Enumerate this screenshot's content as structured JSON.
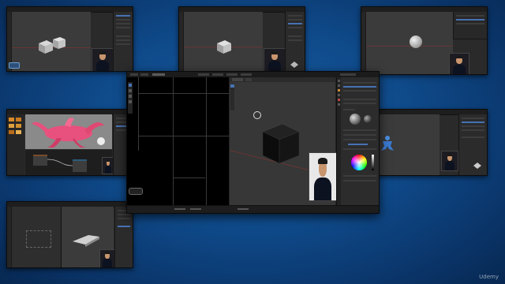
{
  "watermark": "Udemy",
  "colors": {
    "background": "#0f4a8a",
    "blender_dark": "#232323",
    "viewport": "#3b3b3b",
    "selection_blue": "#4772b3",
    "axis_red": "#7a3434",
    "axis_green": "#5b7a2b",
    "pink_creature": "#e8507e"
  },
  "thumbnails": [
    {
      "content": "two-cubes"
    },
    {
      "content": "single-cube"
    },
    {
      "content": "sphere"
    },
    {
      "content": "pink-creature"
    },
    {
      "content": "blue-figure"
    },
    {
      "content": "flat-object"
    }
  ],
  "main_window": {
    "content": "black-cube-with-webcam",
    "icons": [
      "color-wheel-icon",
      "webcam-feed",
      "cursor-icon"
    ]
  }
}
